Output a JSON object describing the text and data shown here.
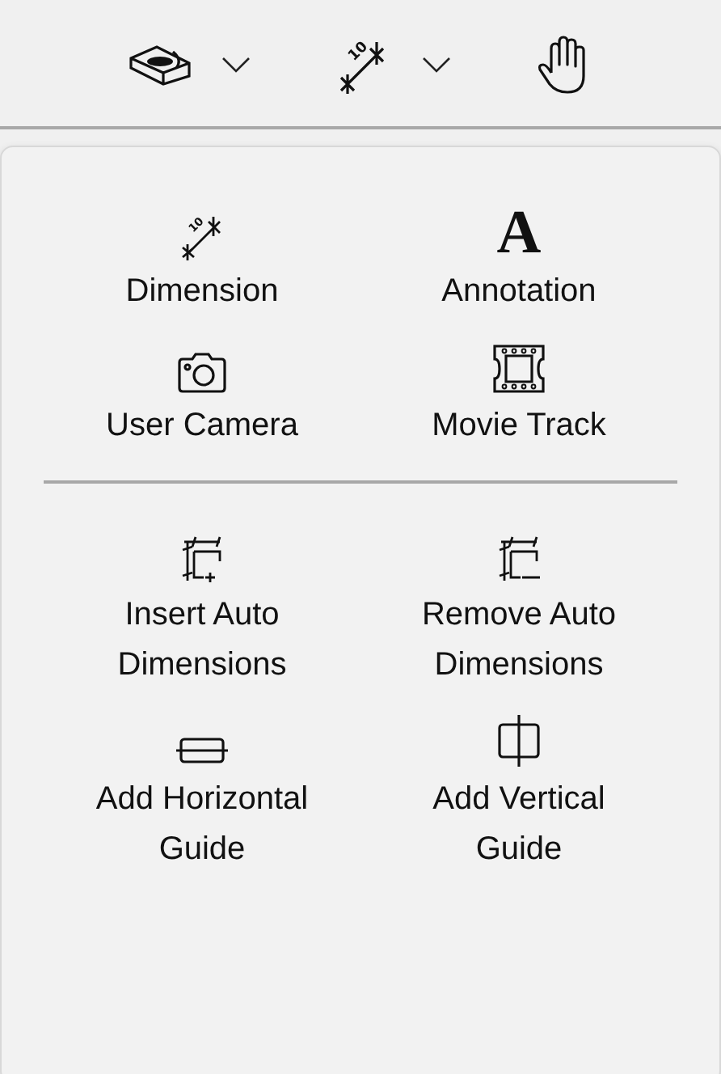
{
  "toolbar": {
    "buttons": [
      {
        "kind": "dropdown"
      },
      {
        "kind": "dropdown",
        "glyph": "10"
      },
      {
        "kind": "plain"
      }
    ]
  },
  "menu": {
    "groups": [
      {
        "items": [
          {
            "label": "Dimension",
            "glyph": "10"
          },
          {
            "label": "Annotation",
            "glyph": "A"
          },
          {
            "label": "User Camera"
          },
          {
            "label": "Movie Track"
          }
        ]
      },
      {
        "items": [
          {
            "label": "Insert Auto Dimensions"
          },
          {
            "label": "Remove Auto Dimensions"
          },
          {
            "label": "Add Horizontal Guide"
          },
          {
            "label": "Add Vertical Guide"
          }
        ]
      }
    ]
  }
}
